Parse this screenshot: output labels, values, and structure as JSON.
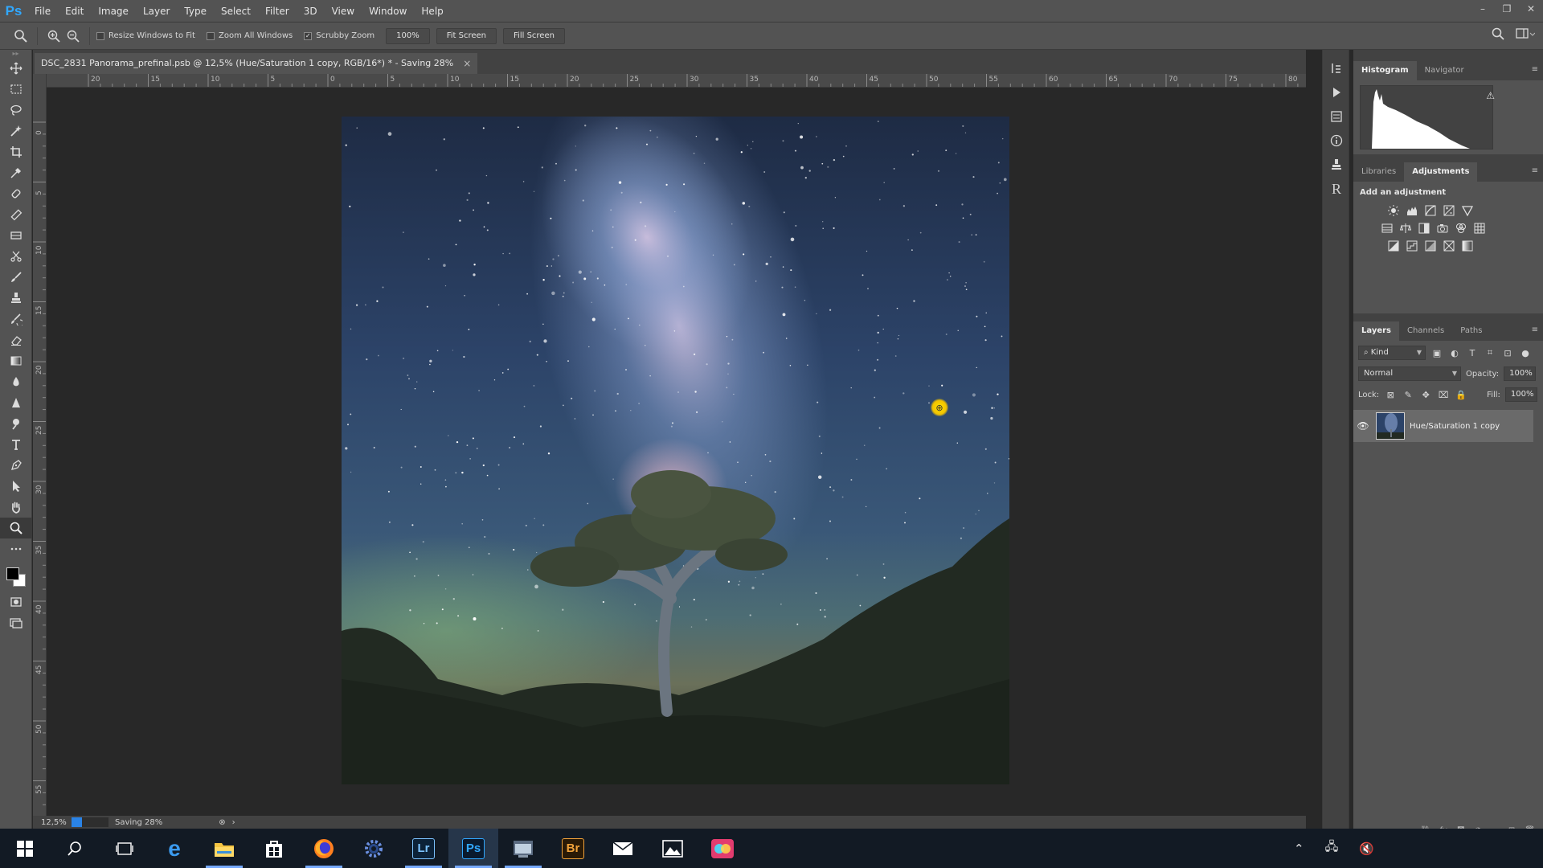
{
  "app": {
    "logo": "Ps"
  },
  "menubar": {
    "items": [
      {
        "label": "File"
      },
      {
        "label": "Edit"
      },
      {
        "label": "Image"
      },
      {
        "label": "Layer"
      },
      {
        "label": "Type"
      },
      {
        "label": "Select"
      },
      {
        "label": "Filter"
      },
      {
        "label": "3D"
      },
      {
        "label": "View"
      },
      {
        "label": "Window"
      },
      {
        "label": "Help"
      }
    ],
    "window_controls": {
      "minimize": "–",
      "restore": "❐",
      "close": "✕"
    }
  },
  "options_bar": {
    "resize_windows": {
      "label": "Resize Windows to Fit",
      "checked": false
    },
    "zoom_all": {
      "label": "Zoom All Windows",
      "checked": false
    },
    "scrubby_zoom": {
      "label": "Scrubby Zoom",
      "checked": true
    },
    "btn_100": "100%",
    "btn_fit": "Fit Screen",
    "btn_fill": "Fill Screen",
    "check_mark": "✓"
  },
  "document": {
    "tab_title": "DSC_2831 Panorama_prefinal.psb @ 12,5% (Hue/Saturation 1 copy, RGB/16*) * - Saving 28%",
    "close": "×"
  },
  "rulers": {
    "top": [
      "20",
      "15",
      "10",
      "5",
      "0",
      "5",
      "10",
      "15",
      "20",
      "25",
      "30",
      "35",
      "40",
      "45",
      "50",
      "55",
      "60",
      "65",
      "70",
      "75",
      "80"
    ],
    "left": [
      "0",
      "5",
      "1​0",
      "1​5",
      "2​0",
      "2​5",
      "3​0",
      "3​5",
      "4​0",
      "4​5",
      "5​0",
      "5​5"
    ]
  },
  "status_bar": {
    "zoom": "12,5%",
    "progress": 0.28,
    "progress_text": "Saving 28%",
    "cancel": "⊗",
    "arrow": "›"
  },
  "panels": {
    "histogram": {
      "tabs": [
        "Histogram",
        "Navigator"
      ],
      "active": 0,
      "warning": "⚠"
    },
    "adjustments": {
      "tabs": [
        "Libraries",
        "Adjustments"
      ],
      "active": 1,
      "title": "Add an adjustment"
    },
    "layers": {
      "tabs": [
        "Layers",
        "Channels",
        "Paths"
      ],
      "active": 0,
      "filter_kind": "Kind",
      "blend_mode": "Normal",
      "opacity_label": "Opacity:",
      "opacity_value": "100%",
      "lock_label": "Lock:",
      "fill_label": "Fill:",
      "fill_value": "100%",
      "items": [
        {
          "name": "Hue/Saturation 1 copy",
          "visible": true
        }
      ]
    },
    "menu_glyph": "≡"
  },
  "colors": {
    "accent_blue": "#2a83e6",
    "ps_blue": "#31a8ff",
    "foreground": "#000000",
    "background": "#ffffff"
  },
  "taskbar": {
    "apps": [
      {
        "name": "start-icon",
        "label": ""
      },
      {
        "name": "search-icon",
        "label": ""
      },
      {
        "name": "task-view-icon",
        "label": ""
      },
      {
        "name": "edge-icon",
        "label": "e"
      },
      {
        "name": "file-explorer-icon",
        "label": ""
      },
      {
        "name": "store-icon",
        "label": ""
      },
      {
        "name": "firefox-icon",
        "label": ""
      },
      {
        "name": "settings-app-icon",
        "label": ""
      },
      {
        "name": "lightroom-icon",
        "label": "Lr"
      },
      {
        "name": "photoshop-icon",
        "label": "Ps"
      },
      {
        "name": "window-app-icon",
        "label": ""
      },
      {
        "name": "bridge-icon",
        "label": "Br"
      },
      {
        "name": "mail-icon",
        "label": ""
      },
      {
        "name": "photos-icon",
        "label": ""
      },
      {
        "name": "color-app-icon",
        "label": ""
      }
    ],
    "tray": {
      "chevron": "⌃",
      "network": "🖧",
      "volume": "🔇"
    }
  }
}
